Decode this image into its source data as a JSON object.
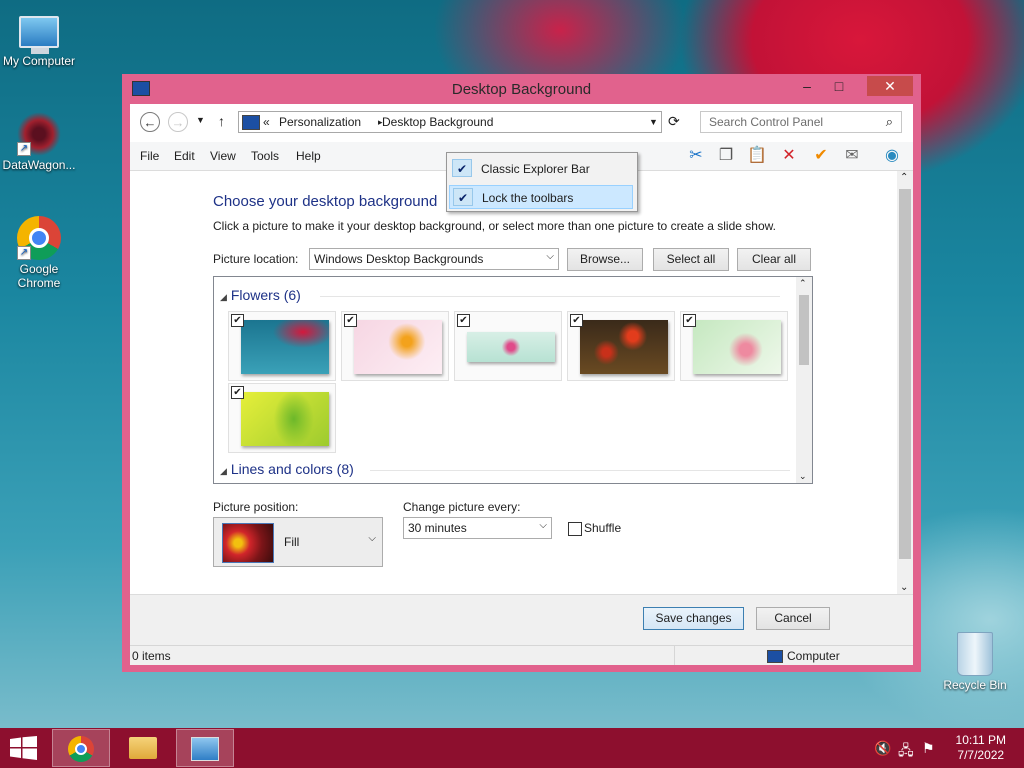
{
  "desktop_icons": [
    {
      "label": "My Computer"
    },
    {
      "label": "DataWagon..."
    },
    {
      "label": "Google Chrome"
    },
    {
      "label": "Recycle Bin"
    }
  ],
  "window": {
    "title": "Desktop Background",
    "buttons": {
      "minimize": "–",
      "maximize": "□",
      "close": "✕"
    }
  },
  "address": {
    "chevron": "«",
    "crumbs": [
      "Personalization",
      "Desktop Background"
    ],
    "separator": "▸"
  },
  "search": {
    "placeholder": "Search Control Panel"
  },
  "menubar": [
    "File",
    "Edit",
    "View",
    "Tools",
    "Help"
  ],
  "context_menu": {
    "items": [
      {
        "label": "Classic Explorer Bar",
        "checked": true
      },
      {
        "label": "Lock the toolbars",
        "checked": true,
        "highlighted": true
      }
    ]
  },
  "content": {
    "heading": "Choose your desktop background",
    "subtext": "Click a picture to make it your desktop background, or select more than one picture to create a slide show.",
    "picture_location_label": "Picture location:",
    "picture_location_value": "Windows Desktop Backgrounds",
    "browse": "Browse...",
    "select_all": "Select all",
    "clear_all": "Clear all",
    "groups": [
      {
        "label": "Flowers (6)"
      },
      {
        "label": "Lines and colors (8)"
      }
    ],
    "picture_position_label": "Picture position:",
    "picture_position_value": "Fill",
    "change_every_label": "Change picture every:",
    "change_every_value": "30 minutes",
    "shuffle_label": "Shuffle"
  },
  "footer": {
    "save": "Save changes",
    "cancel": "Cancel"
  },
  "status": {
    "items": "0 items",
    "location": "Computer"
  },
  "taskbar": {
    "time": "10:11 PM",
    "date": "7/7/2022"
  },
  "colors": {
    "window_frame": "#e1628d",
    "taskbar": "#8d0f2e",
    "heading": "#1e3287"
  }
}
